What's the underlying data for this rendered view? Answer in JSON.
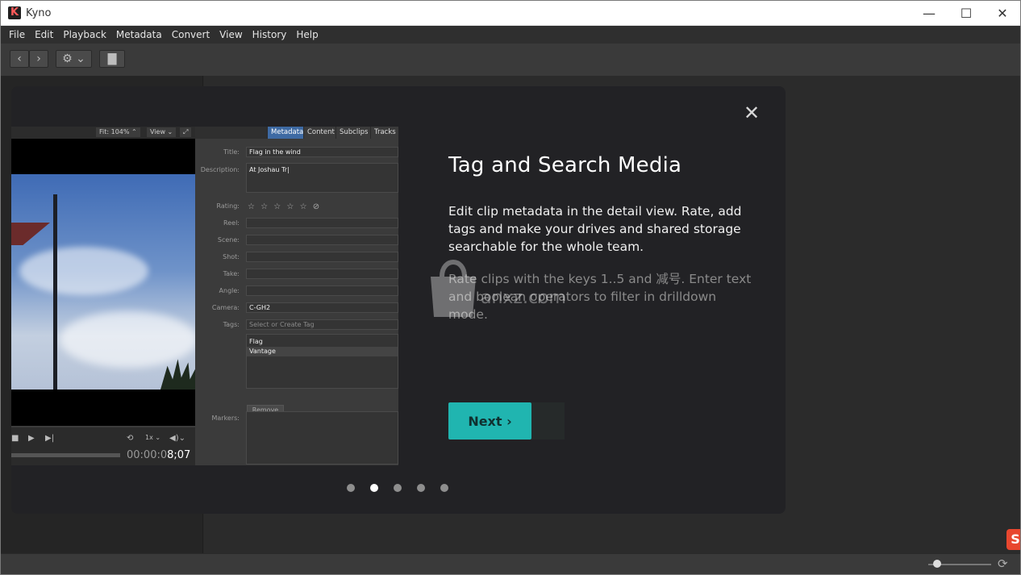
{
  "window": {
    "title": "Kyno",
    "controls": {
      "minimize": "—",
      "maximize": "☐",
      "close": "✕"
    }
  },
  "menubar": [
    "File",
    "Edit",
    "Playback",
    "Metadata",
    "Convert",
    "View",
    "History",
    "Help"
  ],
  "toolbar": {
    "back_icon": "chevron-left-icon",
    "forward_icon": "chevron-right-icon",
    "settings_icon": "gear-icon",
    "folder_icon": "folder-download-icon"
  },
  "dialog": {
    "close_label": "✕",
    "heading": "Tag and Search Media",
    "paragraph_1": "Edit clip metadata in the detail view. Rate, add tags and make your drives and shared storage searchable for the whole team.",
    "paragraph_2": "Rate clips with the keys 1..5 and 减号. Enter text and boolean operators to filter in drilldown mode.",
    "next_label": "Next ›",
    "dots": {
      "count": 5,
      "active_index": 1
    },
    "accent_color": "#20b5b0"
  },
  "screenshot": {
    "fit_label": "Fit: 104% ⌃",
    "view_label": "View ⌄",
    "tabs": [
      "Metadata",
      "Content",
      "Subclips",
      "Tracks"
    ],
    "active_tab": "Metadata",
    "fields": {
      "title_label": "Title:",
      "title_value": "Flag in the wind",
      "description_label": "Description:",
      "description_value": "At Joshau Tr|",
      "rating_label": "Rating:",
      "rating_value": "☆ ☆ ☆ ☆ ☆  ⊘",
      "reel_label": "Reel:",
      "scene_label": "Scene:",
      "shot_label": "Shot:",
      "take_label": "Take:",
      "angle_label": "Angle:",
      "camera_label": "Camera:",
      "camera_value": "C-GH2",
      "tags_label": "Tags:",
      "tags_placeholder": "Select or Create Tag",
      "tags": [
        "Flag",
        "Vantage"
      ],
      "remove_label": "Remove",
      "markers_label": "Markers:"
    },
    "playback": {
      "speed": "1x ⌄",
      "timecode_dim": "00:00:0",
      "timecode_bright": "8;07"
    }
  },
  "watermark": {
    "text": "anxz.com"
  }
}
